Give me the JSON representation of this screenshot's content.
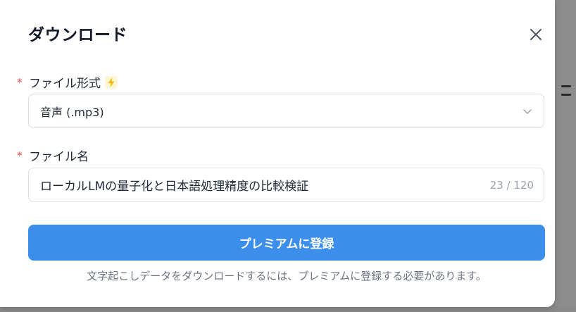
{
  "dialog": {
    "title": "ダウンロード",
    "close_label": "×"
  },
  "fields": {
    "format": {
      "required_mark": "*",
      "label": "ファイル形式",
      "selected": "音声 (.mp3)"
    },
    "filename": {
      "required_mark": "*",
      "label": "ファイル名",
      "value": "ローカルLMの量子化と日本語処理精度の比較検証",
      "count": "23 / 120"
    }
  },
  "actions": {
    "premium_button": "プレミアムに登録",
    "note": "文字起こしデータをダウンロードするには、プレミアムに登録する必要があります。"
  },
  "icons": {
    "close": "close-icon",
    "bolt": "bolt-icon",
    "chevron": "chevron-down-icon"
  },
  "colors": {
    "primary": "#3b8eea",
    "required": "#ef4444",
    "bolt": "#f5b800"
  }
}
